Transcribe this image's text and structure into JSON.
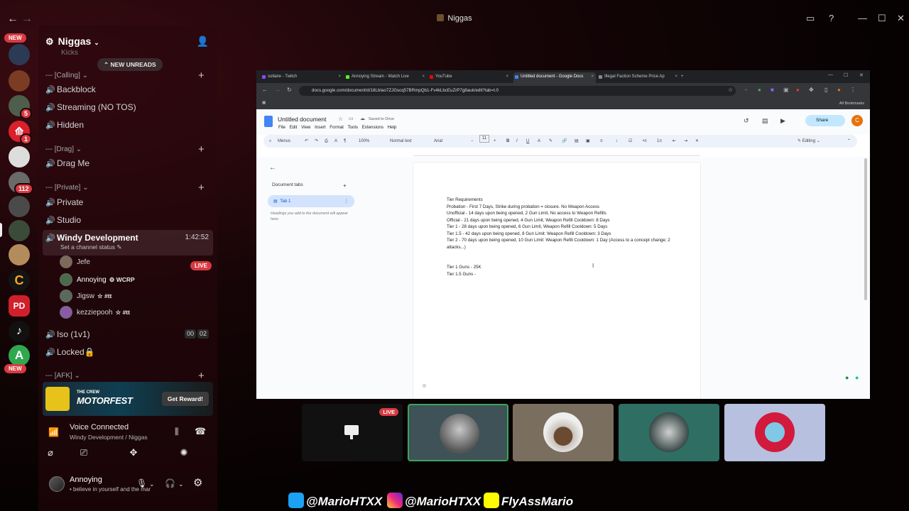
{
  "window": {
    "title": "Niggas",
    "back_icon": "←",
    "forward_icon": "→"
  },
  "rail": {
    "new_label_top": "NEW",
    "new_label_bottom": "NEW",
    "badge_5": "5",
    "badge_1": "1",
    "badge_112": "112",
    "pd_label": "PD",
    "a_label": "A"
  },
  "panel": {
    "server_name": "Niggas",
    "new_unreads": "NEW UNREADS",
    "partial_top": "Kicks",
    "categories": {
      "calling": "--- [Calling]",
      "drag": "--- [Drag]",
      "private": "--- [Private]",
      "afk": "--- [AFK]"
    },
    "channels": {
      "backblock": "Backblock",
      "streaming": "Streaming (NO TOS)",
      "hidden": "Hidden",
      "drag_me": "Drag Me",
      "private": "Private",
      "studio": "Studio",
      "windy": "Windy Development",
      "windy_time": "1:42:52",
      "iso": "Iso (1v1)",
      "iso_a": "00",
      "iso_b": "02",
      "locked": "Locked🔒"
    },
    "set_status": "Set a channel status",
    "live_label": "LIVE",
    "users": [
      {
        "name": "Jefe",
        "tag": ""
      },
      {
        "name": "Annoying",
        "tag": "WCRP"
      },
      {
        "name": "Jigsw",
        "tag": "#tt"
      },
      {
        "name": "kezziepooh",
        "tag": "#tt"
      }
    ],
    "promo": {
      "line1": "THE CREW",
      "line2": "MOTORFEST",
      "button": "Get Reward!"
    },
    "voice": {
      "status": "Voice Connected",
      "channel": "Windy Development / Niggas"
    },
    "me": {
      "name": "Annoying",
      "status": "believe in yourself and the mar"
    }
  },
  "browser": {
    "tabs": [
      {
        "label": "sollaire - Twitch",
        "color": "#9146ff"
      },
      {
        "label": "Annoying Stream - Watch Live",
        "color": "#53fc18"
      },
      {
        "label": "YouTube",
        "color": "#ff0000"
      },
      {
        "label": "Untitled document - Google Docs",
        "color": "#4285f4"
      },
      {
        "label": "Illegal Faction Scheme Price Ap",
        "color": "#888888"
      }
    ],
    "url": "docs.google.com/document/d/18LbIao7ZJGscq57BRmpQb1-Fv4kLbcEuZrP7g8auk/edit?tab=t.0",
    "all_bookmarks": "All Bookmarks",
    "doc_title": "Untitled document",
    "saved": "Saved to Drive",
    "menus": "File Edit View Insert Format Tools Extensions Help",
    "share": "Share",
    "avatar_letter": "C",
    "toolbar": {
      "menus": "Menus",
      "zoom": "100%",
      "style": "Normal text",
      "font": "Arial",
      "size": "11",
      "editing": "Editing"
    },
    "outline": {
      "title": "Document tabs",
      "tab": "Tab 1",
      "hint": "Headings you add to the document will appear here."
    },
    "doc_lines": [
      "Tier Requirements",
      "Probation - First 7 Days, Strike during probation = closure. No Weapon Access",
      "Unofficial - 14 days upon being opened, 2 Gun Limit, No access to Weapon Refills",
      "Official - 21 days upon being opened, 4 Gun Limit, Weapon Refill Cooldown: 8 Days",
      "Tier 1 - 28 days upon being opened, 6 Gun Limit, Weapon Refill Cooldown: 5 Days",
      "Tier 1.5 - 42 days upon being opened, 8 Gun Limit: Weapon Refill Cooldown: 3 Days",
      "Tier 2 - 70 days upon being opened, 10 Gun Limit: Weapon Refill Cooldown: 1 Day (Access to a concept change; 2 attacks...)",
      "",
      "",
      "Tier 1 Guns - 25K",
      "Tier 1.5 Guns -"
    ]
  },
  "tiles": {
    "live_label": "LIVE"
  },
  "watermark": {
    "twitter": "@MarioHTXX",
    "instagram": "@MarioHTXX",
    "snapchat": "FlyAssMario"
  }
}
